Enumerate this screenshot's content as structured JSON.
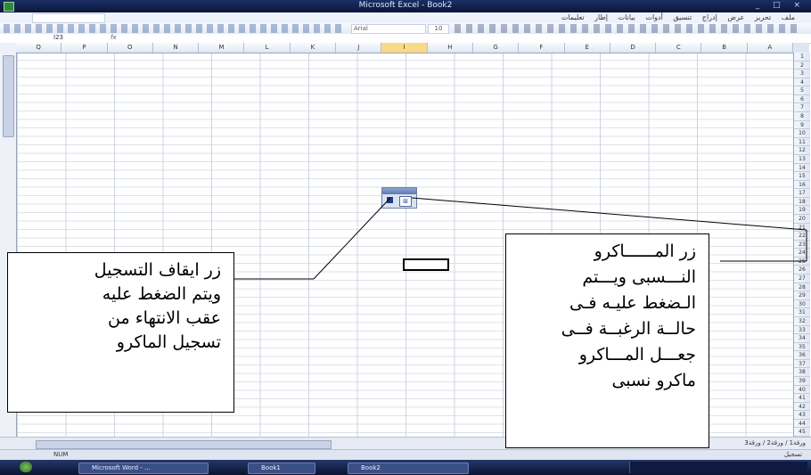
{
  "window": {
    "title": "Microsoft Excel - Book2"
  },
  "menubar": {
    "items": [
      "ملف",
      "تحرير",
      "عرض",
      "إدراج",
      "تنسيق",
      "أدوات",
      "بيانات",
      "إطار",
      "تعليمات"
    ]
  },
  "toolbar": {
    "font_name": "Arial",
    "font_size": "10"
  },
  "formula_bar": {
    "name_box": "I23",
    "fx": "fx"
  },
  "columns": [
    "Q",
    "P",
    "O",
    "N",
    "M",
    "L",
    "K",
    "J",
    "I",
    "H",
    "G",
    "F",
    "E",
    "D",
    "C",
    "B",
    "A"
  ],
  "selected_column": "I",
  "rows": [
    "1",
    "2",
    "3",
    "4",
    "5",
    "6",
    "7",
    "8",
    "9",
    "10",
    "11",
    "12",
    "13",
    "14",
    "15",
    "16",
    "17",
    "18",
    "19",
    "20",
    "21",
    "22",
    "23",
    "24",
    "25",
    "26",
    "27",
    "28",
    "29",
    "30",
    "31",
    "32",
    "33",
    "34",
    "35",
    "36",
    "37",
    "38",
    "39",
    "40",
    "41",
    "42",
    "43",
    "44",
    "45"
  ],
  "macro_toolbar": {
    "title": "Sto",
    "stop_icon": "stop-recording-icon",
    "relative_icon": "relative-reference-icon"
  },
  "sheet_tabs": "ورقة1 / ورقة2 / ورقة3",
  "status": {
    "left": "NUM",
    "right": "تسجيل"
  },
  "taskbar": {
    "task1": "Microsoft Word - ...",
    "task2": "Book1",
    "task3": "Book2"
  },
  "annotations": {
    "stop_button": [
      "زر ايقاف التسجيل",
      "ويتم الضغط عليه",
      "عقب الانتهاء من",
      "تسجيل الماكرو"
    ],
    "relative_button": [
      "زر المــــــاكرو",
      "النـــسبى ويـــتم",
      "الـضغط عليـه فـى",
      "حالــة الرغبــة فــى",
      "جعـــل المـــاكرو",
      "ماكرو نسبى"
    ]
  }
}
